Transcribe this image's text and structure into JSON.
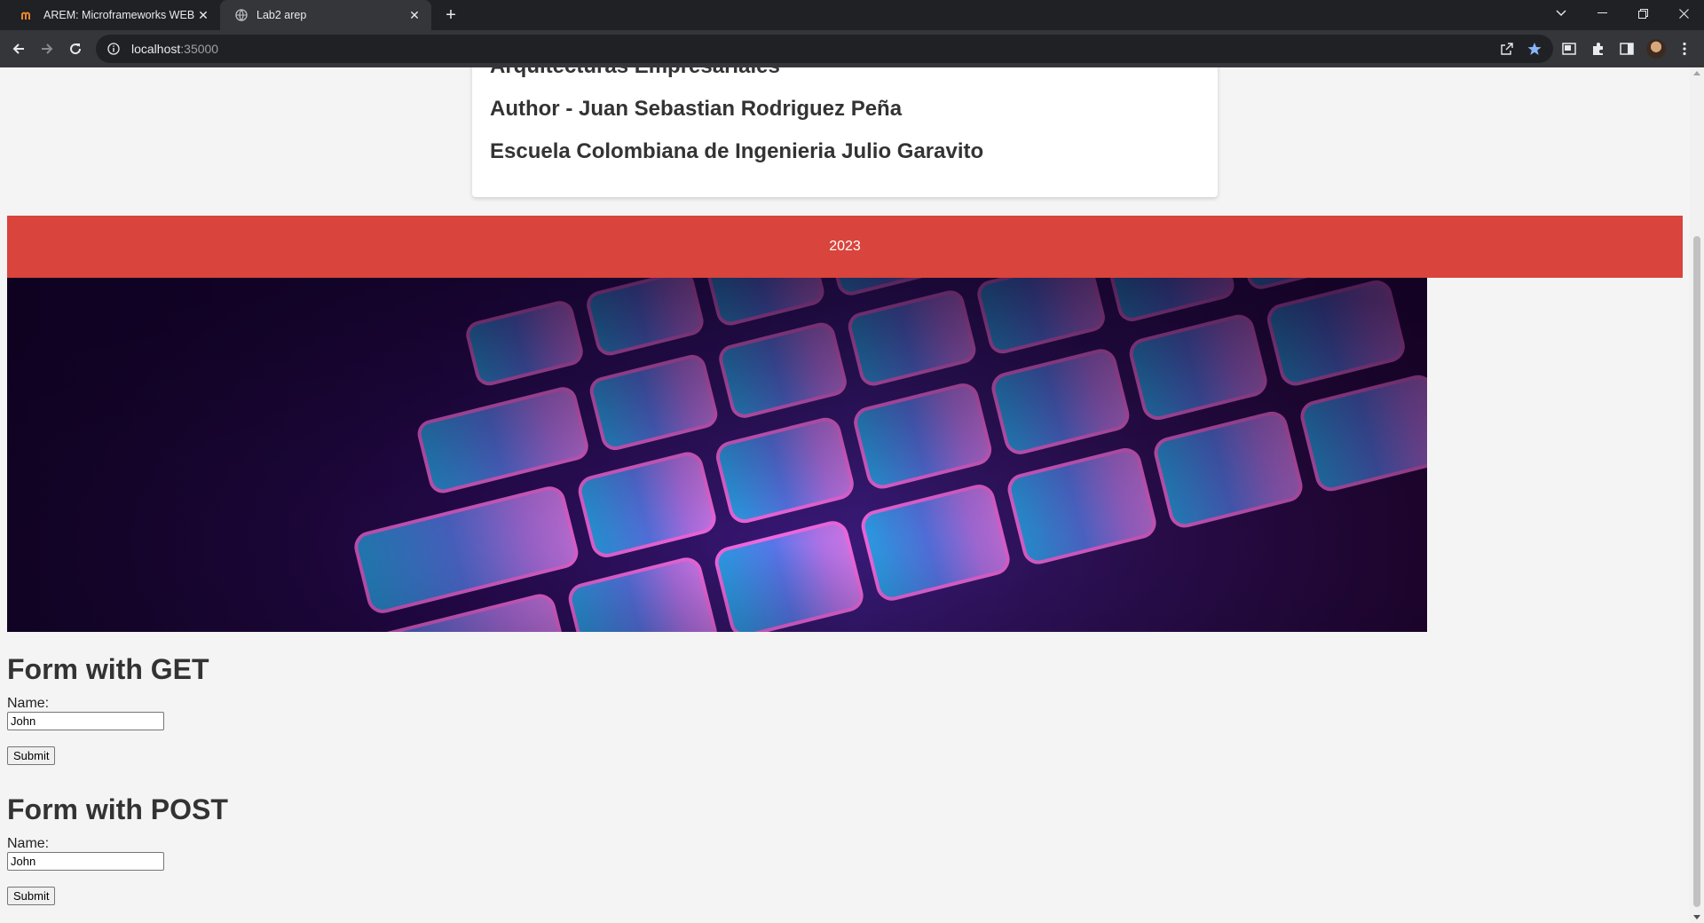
{
  "browser": {
    "tabs": [
      {
        "title": "AREM: Microframeworks WEB",
        "favicon": "m-favicon-icon",
        "active": false
      },
      {
        "title": "Lab2 arep",
        "favicon": "globe-icon",
        "active": true
      }
    ],
    "address": {
      "host": "localhost",
      "port": ":35000"
    }
  },
  "page": {
    "header_card": {
      "line_top": "Arquitecturas Empresariales",
      "author": "Author - Juan Sebastian Rodriguez Peña",
      "school": "Escuela Colombiana de Ingenieria Julio Garavito"
    },
    "footer": {
      "year": "2023",
      "color": "#d9443c"
    },
    "forms": [
      {
        "title": "Form with GET",
        "label": "Name:",
        "value": "John",
        "submit": "Submit"
      },
      {
        "title": "Form with POST",
        "label": "Name:",
        "value": "John",
        "submit": "Submit"
      }
    ]
  }
}
